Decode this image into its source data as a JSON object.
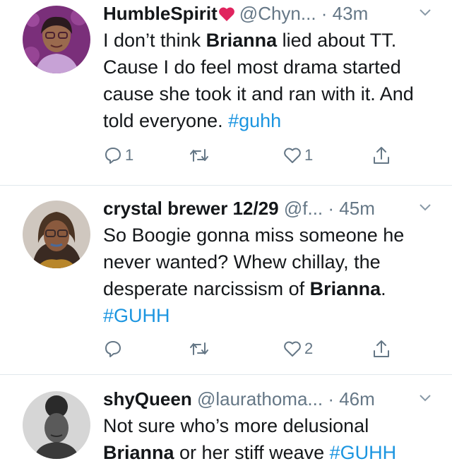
{
  "tweets": [
    {
      "name": "HumbleSpirit",
      "handle": "@Chyn...",
      "time": "· 43m",
      "text_parts": [
        "I don’t think ",
        "Brianna",
        " lied about TT. Cause I do feel most drama started cause she took it and ran with it. And told everyone. ",
        "#guhh"
      ],
      "replies": "1",
      "likes": "1"
    },
    {
      "name": "crystal brewer 12/29",
      "handle": "@f...",
      "time": "· 45m",
      "text_parts": [
        "So Boogie gonna miss someone he never wanted? Whew chillay, the desperate narcissism of ",
        "Brianna",
        ".",
        "#GUHH"
      ],
      "replies": "",
      "likes": "2"
    },
    {
      "name": "shyQueen",
      "handle": "@laurathoma...",
      "time": "· 46m",
      "text_parts": [
        "Not sure who’s more delusional ",
        "Brianna",
        " or her stiff weave ",
        "#GUHH"
      ]
    }
  ],
  "icons": {
    "reply": "reply-icon",
    "retweet": "retweet-icon",
    "like": "like-icon",
    "share": "share-icon",
    "caret": "chevron-down-icon",
    "emoji": "red-heart-icon"
  },
  "colors": {
    "link": "#1b95e0",
    "secondary": "#657786",
    "divider": "#e1e8ed",
    "heart": "#e0245e"
  }
}
